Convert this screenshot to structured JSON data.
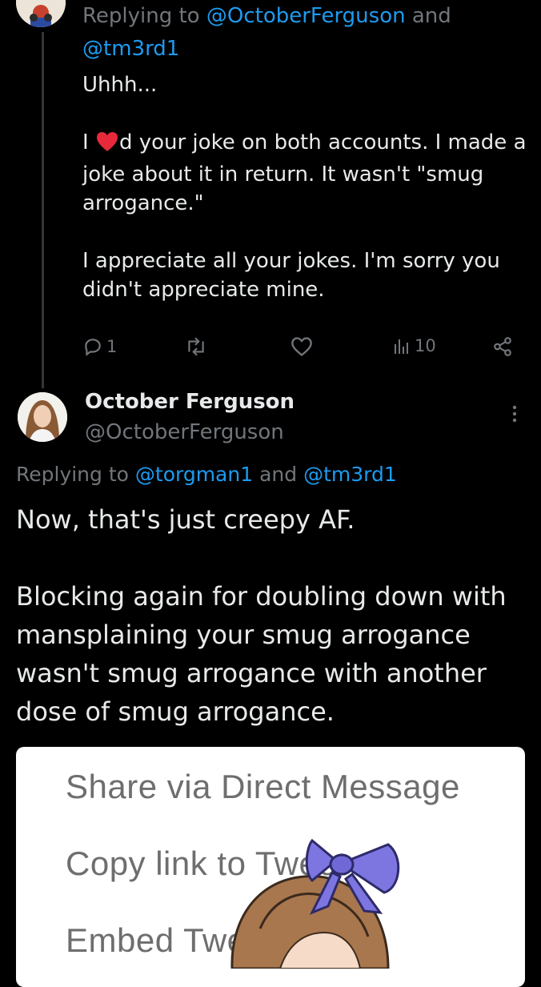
{
  "reply_tweet": {
    "replying_prefix": "Replying to ",
    "mention_1": "@OctoberFerguson",
    "and_word": " and",
    "mention_2": "@tm3rd1",
    "line_1": "Uhhh...",
    "line_2a": "I ",
    "line_2b": "d your joke on both accounts. I made a joke about it in return. It wasn't \"smug arrogance.\"",
    "line_3": "I appreciate all your jokes. I'm sorry you didn't appreciate mine.",
    "reply_count": "1",
    "view_count": "10"
  },
  "main_tweet": {
    "display_name": "October Ferguson",
    "handle": "@OctoberFerguson",
    "replying_prefix": "Replying to ",
    "mention_1": "@torgman1",
    "and_word": " and ",
    "mention_2": "@tm3rd1",
    "paragraph_1": "Now, that's just creepy AF.",
    "paragraph_2": "Blocking again for doubling down with mansplaining your smug arrogance wasn't smug arrogance with another dose of smug arrogance."
  },
  "share_menu": {
    "item_1": "Share via Direct Message",
    "item_2": "Copy link to Tweet",
    "item_3": "Embed Tweet"
  },
  "colors": {
    "background": "#000000",
    "text": "#e7e9ea",
    "muted": "#71767b",
    "accent": "#1d9bf0",
    "heart": "#f91880"
  },
  "icons": [
    "reply-icon",
    "retweet-icon",
    "like-icon",
    "views-icon",
    "share-icon",
    "more-icon",
    "red-heart-emoji"
  ]
}
